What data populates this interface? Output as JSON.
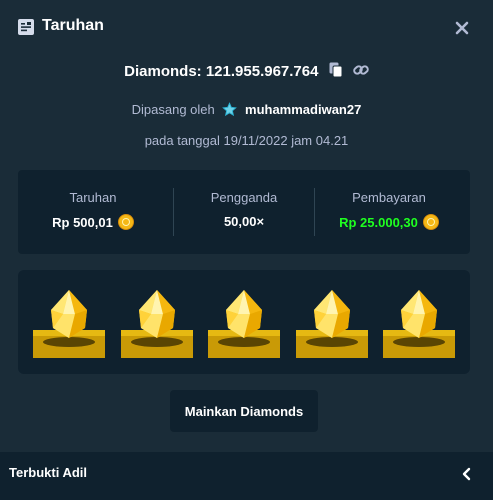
{
  "header": {
    "title": "Taruhan",
    "icon": "receipt-icon",
    "close_icon": "close-icon"
  },
  "bet": {
    "game_line": "Diamonds: 121.955.967.764",
    "placed_by_label": "Dipasang oleh",
    "username": "muhammadiwan27",
    "date_line": "pada tanggal 19/11/2022 jam 04.21"
  },
  "stats": [
    {
      "label": "Taruhan",
      "value": "Rp 500,01"
    },
    {
      "label": "Pengganda",
      "value": "50,00×"
    },
    {
      "label": "Pembayaran",
      "value": "Rp 25.000,30"
    }
  ],
  "gems": {
    "count": 5,
    "color": "#f7c91b"
  },
  "actions": {
    "play_label": "Mainkan Diamonds"
  },
  "footer": {
    "label": "Terbukti Adil"
  },
  "colors": {
    "background": "#1a2c38",
    "panel": "#0f212e",
    "muted_text": "#b1bad3",
    "payout_green": "#1fff20",
    "coin": "#f5b816"
  }
}
